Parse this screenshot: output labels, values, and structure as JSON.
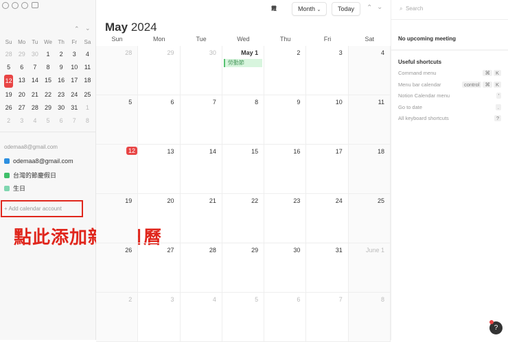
{
  "sidebar": {
    "weekdays": [
      "Su",
      "Mo",
      "Tu",
      "We",
      "Th",
      "Fr",
      "Sa"
    ],
    "days": [
      [
        "28",
        1
      ],
      [
        "29",
        1
      ],
      [
        "30",
        1
      ],
      [
        "1",
        0
      ],
      [
        "2",
        0
      ],
      [
        "3",
        0
      ],
      [
        "4",
        0
      ],
      [
        "5",
        0
      ],
      [
        "6",
        0
      ],
      [
        "7",
        0
      ],
      [
        "8",
        0
      ],
      [
        "9",
        0
      ],
      [
        "10",
        0
      ],
      [
        "11",
        0
      ],
      [
        "12",
        2
      ],
      [
        "13",
        0
      ],
      [
        "14",
        0
      ],
      [
        "15",
        0
      ],
      [
        "16",
        0
      ],
      [
        "17",
        0
      ],
      [
        "18",
        0
      ],
      [
        "19",
        0
      ],
      [
        "20",
        0
      ],
      [
        "21",
        0
      ],
      [
        "22",
        0
      ],
      [
        "23",
        0
      ],
      [
        "24",
        0
      ],
      [
        "25",
        0
      ],
      [
        "26",
        0
      ],
      [
        "27",
        0
      ],
      [
        "28",
        0
      ],
      [
        "29",
        0
      ],
      [
        "30",
        0
      ],
      [
        "31",
        0
      ],
      [
        "1",
        1
      ],
      [
        "2",
        1
      ],
      [
        "3",
        1
      ],
      [
        "4",
        1
      ],
      [
        "5",
        1
      ],
      [
        "6",
        1
      ],
      [
        "7",
        1
      ],
      [
        "8",
        1
      ]
    ],
    "account": "odemaa8@gmail.com",
    "calendars": [
      {
        "label": "odemaa8@gmail.com",
        "color": "#2d8fe0"
      },
      {
        "label": "台灣的節慶假日",
        "color": "#3fbf6a"
      },
      {
        "label": "生日",
        "color": "#7fd6b0"
      }
    ],
    "add_account": "+ Add calendar account",
    "annotation": "點此添加新的日曆"
  },
  "header": {
    "title_month": "May",
    "title_year": "2024",
    "view": "Month",
    "today": "Today",
    "logo_text": "霞"
  },
  "weekdays": [
    "Sun",
    "Mon",
    "Tue",
    "Wed",
    "Thu",
    "Fri",
    "Sat"
  ],
  "cells": [
    [
      "28",
      1
    ],
    [
      "29",
      1
    ],
    [
      "30",
      1
    ],
    [
      "May 1",
      0
    ],
    [
      "2",
      0
    ],
    [
      "3",
      0
    ],
    [
      "4",
      0
    ],
    [
      "5",
      0
    ],
    [
      "6",
      0
    ],
    [
      "7",
      0
    ],
    [
      "8",
      0
    ],
    [
      "9",
      0
    ],
    [
      "10",
      0
    ],
    [
      "11",
      0
    ],
    [
      "12",
      2
    ],
    [
      "13",
      0
    ],
    [
      "14",
      0
    ],
    [
      "15",
      0
    ],
    [
      "16",
      0
    ],
    [
      "17",
      0
    ],
    [
      "18",
      0
    ],
    [
      "19",
      0
    ],
    [
      "20",
      0
    ],
    [
      "21",
      0
    ],
    [
      "22",
      0
    ],
    [
      "23",
      0
    ],
    [
      "24",
      0
    ],
    [
      "25",
      0
    ],
    [
      "26",
      0
    ],
    [
      "27",
      0
    ],
    [
      "28",
      0
    ],
    [
      "29",
      0
    ],
    [
      "30",
      0
    ],
    [
      "31",
      0
    ],
    [
      "June 1",
      1
    ],
    [
      "2",
      1
    ],
    [
      "3",
      1
    ],
    [
      "4",
      1
    ],
    [
      "5",
      1
    ],
    [
      "6",
      1
    ],
    [
      "7",
      1
    ],
    [
      "8",
      1
    ]
  ],
  "events": [
    {
      "cell": 3,
      "title": "勞動節"
    }
  ],
  "right": {
    "search": "Search",
    "no_meeting": "No upcoming meeting",
    "shortcuts_title": "Useful shortcuts",
    "shortcuts": [
      {
        "label": "Command menu",
        "keys": [
          "⌘",
          "K"
        ]
      },
      {
        "label": "Menu bar calendar",
        "keys": [
          "control",
          "⌘",
          "K"
        ]
      },
      {
        "label": "Notion Calendar menu",
        "keys": [
          "'"
        ]
      },
      {
        "label": "Go to date",
        "keys": [
          "."
        ]
      },
      {
        "label": "All keyboard shortcuts",
        "keys": [
          "?"
        ]
      }
    ]
  },
  "help": "?"
}
